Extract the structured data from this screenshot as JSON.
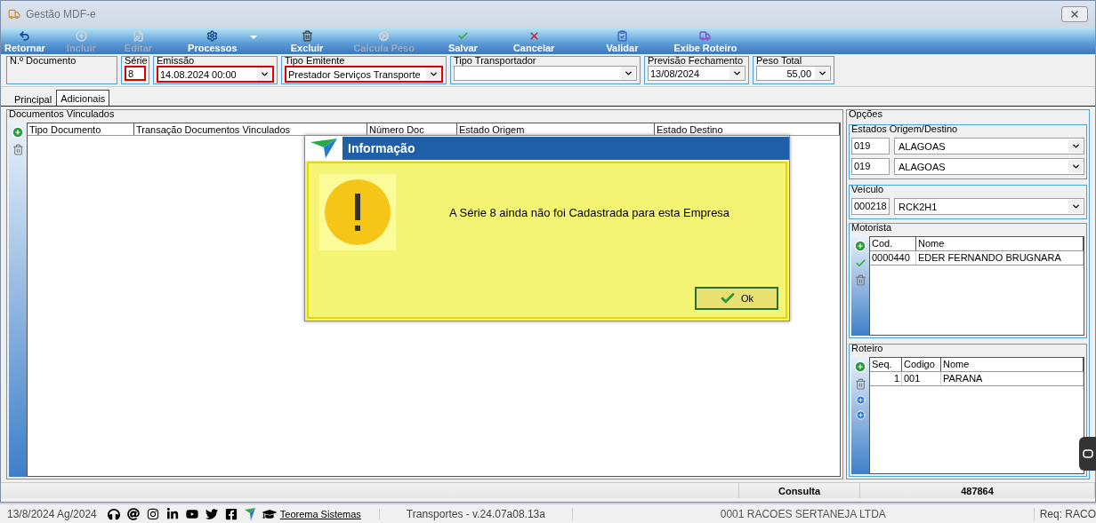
{
  "window": {
    "title": "Gestão MDF-e"
  },
  "toolbar": [
    {
      "label": "Retornar",
      "disabled": false,
      "kind": "button"
    },
    {
      "label": "Incluir",
      "disabled": true,
      "kind": "button"
    },
    {
      "label": "Editar",
      "disabled": true,
      "kind": "button"
    },
    {
      "label": "Processos",
      "disabled": false,
      "kind": "menu"
    },
    {
      "label": "Excluir",
      "disabled": false,
      "kind": "button"
    },
    {
      "label": "Calcula Peso",
      "disabled": true,
      "kind": "button"
    },
    {
      "label": "Salvar",
      "disabled": false,
      "kind": "button"
    },
    {
      "label": "Cancelar",
      "disabled": false,
      "kind": "button"
    },
    {
      "label": "Validar",
      "disabled": false,
      "kind": "button"
    },
    {
      "label": "Exibe Roteiro",
      "disabled": false,
      "kind": "button"
    }
  ],
  "fields": [
    {
      "label": "N.º Documento",
      "kind": "empty"
    },
    {
      "label": "Série",
      "value": "8",
      "kind": "text",
      "invalid": true
    },
    {
      "label": "Emissão",
      "value": "14.08.2024 00:00",
      "kind": "select",
      "invalid": true
    },
    {
      "label": "Tipo Emitente",
      "value": "Prestador Serviços Transporte",
      "kind": "select",
      "invalid": true
    },
    {
      "label": "Tipo Transportador",
      "kind": "select",
      "invalid": false
    },
    {
      "label": "Previsão Fechamento",
      "value": "13/08/2024",
      "kind": "select",
      "invalid": false
    },
    {
      "label": "Peso Total",
      "value": "55,00",
      "kind": "number",
      "invalid": false
    }
  ],
  "tabs": [
    {
      "label": "Principal",
      "selected": false
    },
    {
      "label": "Adicionais",
      "selected": true
    }
  ],
  "documentos": {
    "title": "Documentos Vinculados",
    "columns": [
      "Tipo Documento",
      "Transação Documentos Vinculados",
      "Número Doc",
      "Estado Origem",
      "Estado Destino"
    ]
  },
  "opcoes": {
    "title": "Opções",
    "estados": {
      "title": "Estados Origem/Destino",
      "rows": [
        {
          "code": "019",
          "name": "ALAGOAS"
        },
        {
          "code": "019",
          "name": "ALAGOAS"
        }
      ]
    },
    "veiculo": {
      "title": "Veículo",
      "code": "000218",
      "name": "RCK2H1"
    },
    "motorista": {
      "title": "Motorista",
      "columns": [
        "Cod.",
        "Nome"
      ],
      "rows": [
        [
          "0000440",
          "EDER FERNANDO BRUGNARA"
        ]
      ]
    },
    "roteiro": {
      "title": "Roteiro",
      "columns": [
        "Seq.",
        "Codigo",
        "Nome"
      ],
      "rows": [
        [
          "1",
          "001",
          "PARANA"
        ]
      ]
    }
  },
  "status_bar": [
    "Consulta",
    "487864"
  ],
  "taskbar": {
    "date": "13/8/2024 Ag/2024",
    "link": "Teorema Sistemas",
    "version": "Transportes - v.24.07a08.13a",
    "company": "0001 RACOES SERTANEJA LTDA",
    "user": "Req: RACO"
  },
  "dialog": {
    "title": "Informação",
    "message": "A Série 8 ainda não foi Cadastrada para esta Empresa",
    "button": "Ok"
  }
}
